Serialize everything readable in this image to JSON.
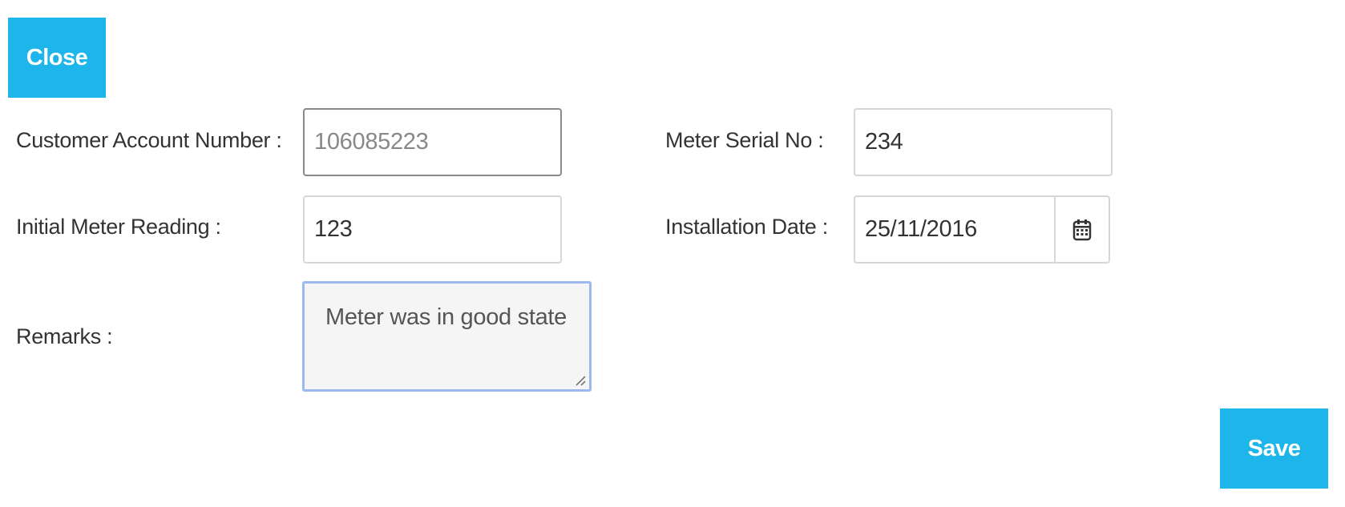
{
  "buttons": {
    "close_label": "Close",
    "save_label": "Save"
  },
  "form": {
    "customer_account_number": {
      "label": "Customer Account Number :",
      "value": "106085223"
    },
    "meter_serial_no": {
      "label": "Meter Serial No :",
      "value": "234"
    },
    "initial_meter_reading": {
      "label": "Initial Meter Reading :",
      "value": "123"
    },
    "installation_date": {
      "label": "Installation Date :",
      "value": "25/11/2016",
      "addon_icon": "calendar-icon"
    },
    "remarks": {
      "label": "Remarks :",
      "value": "Meter was in good state"
    }
  },
  "colors": {
    "button_bg": "#1eb6ea",
    "button_text": "#ffffff",
    "focus_border": "#9bb8f0"
  }
}
